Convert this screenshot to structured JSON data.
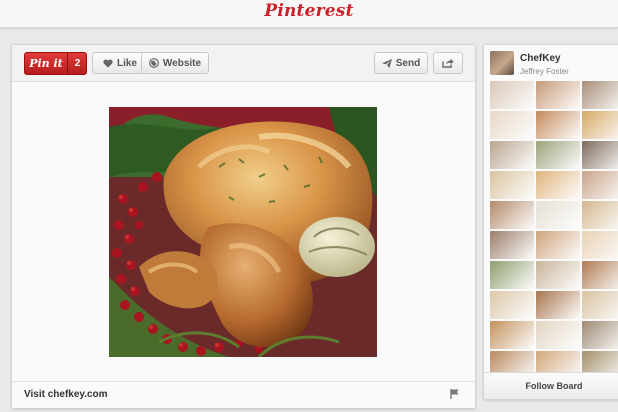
{
  "header": {
    "logo_text": "Pinterest"
  },
  "pin": {
    "pinit_label": "Pin it",
    "repin_count": "2",
    "like_label": "Like",
    "website_label": "Website",
    "send_label": "Send",
    "footer_link": "Visit chefkey.com"
  },
  "board": {
    "name": "ChefKey",
    "owner": "Jeffrey Foster",
    "follow_label": "Follow Board",
    "thumb_colors": [
      "#d9c7b6",
      "#c79a78",
      "#a88f78",
      "#e8d8c8",
      "#c48a5a",
      "#d6a866",
      "#b9a58f",
      "#9aa37a",
      "#7d6b5a",
      "#d9c39e",
      "#e0b47c",
      "#c9a48a",
      "#b48a6a",
      "#e6e0d4",
      "#d4b890",
      "#9c7f6a",
      "#cfa37c",
      "#e8d2b2",
      "#8e9e6e",
      "#c8b49a",
      "#b07a50",
      "#dcc7a7",
      "#a8744c",
      "#d8c2a0",
      "#c4925c",
      "#e2d6c2",
      "#9e8a72",
      "#b88a5e",
      "#d2a67a",
      "#a4906c",
      "#c97a4e",
      "#e4cfae",
      "#b6a089"
    ]
  },
  "colors": {
    "brand_red": "#cb2027",
    "background": "#e9e9e9"
  }
}
